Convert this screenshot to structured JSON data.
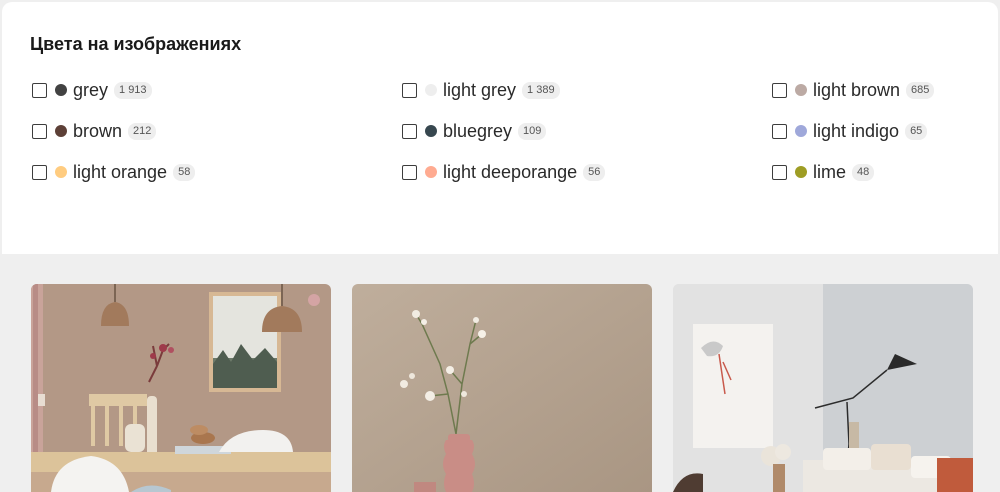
{
  "filter": {
    "title": "Цвета на изображениях",
    "options": [
      {
        "label": "grey",
        "count": "1 913",
        "color": "#424242"
      },
      {
        "label": "light grey",
        "count": "1 389",
        "color": "#eeeeee"
      },
      {
        "label": "light brown",
        "count": "685",
        "color": "#bcaaa4"
      },
      {
        "label": "brown",
        "count": "212",
        "color": "#5d4037"
      },
      {
        "label": "bluegrey",
        "count": "109",
        "color": "#37474f"
      },
      {
        "label": "light indigo",
        "count": "65",
        "color": "#9fa8da"
      },
      {
        "label": "light orange",
        "count": "58",
        "color": "#ffcc80"
      },
      {
        "label": "light deeporange",
        "count": "56",
        "color": "#ffab91"
      },
      {
        "label": "lime",
        "count": "48",
        "color": "#9e9d24"
      }
    ]
  },
  "photos": [
    {
      "subject": "dining room with pendant lamps"
    },
    {
      "subject": "vase with branches on beige wall"
    },
    {
      "subject": "living room with floor lamp and sofa"
    }
  ]
}
